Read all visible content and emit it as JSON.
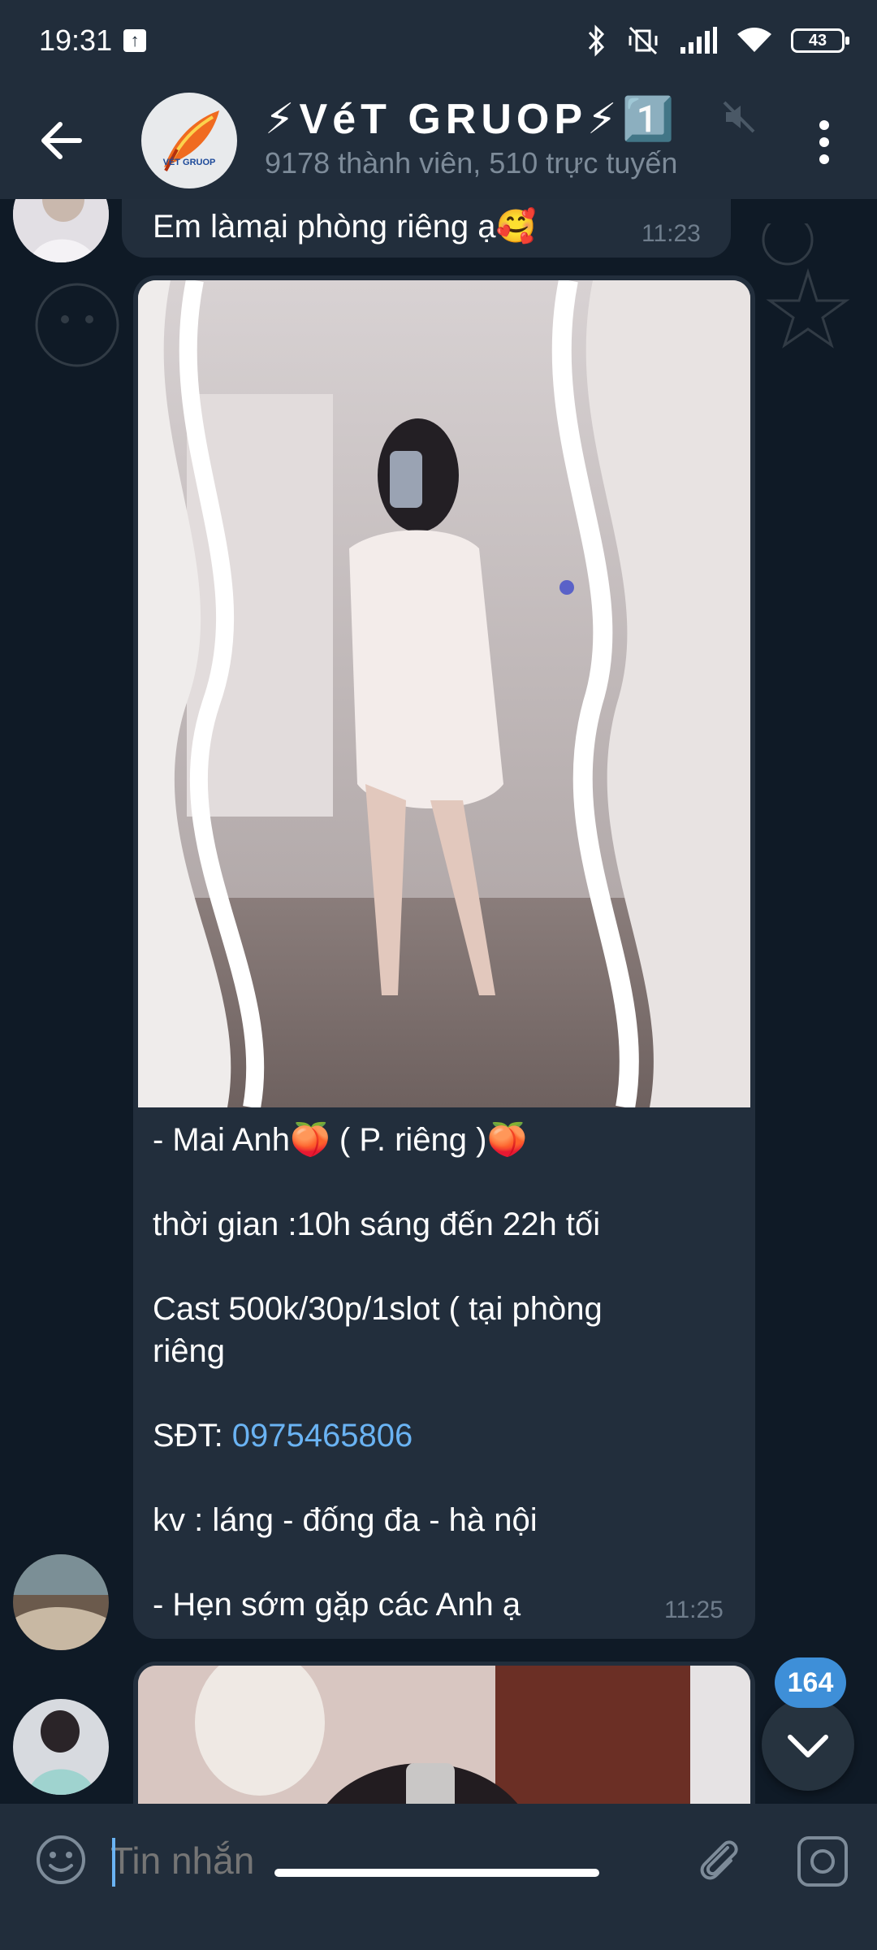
{
  "status_bar": {
    "time": "19:31",
    "battery": "43"
  },
  "header": {
    "title": "⚡VéT GRUOP⚡1️⃣",
    "subtitle": "9178 thành viên, 510 trực tuyến",
    "avatar_text": "VÉT GRUOP"
  },
  "messages": [
    {
      "text": "Em làmại phòng riêng ạ🥰",
      "time": "11:23"
    },
    {
      "caption": [
        "- Mai Anh🍑 ( P. riêng )🍑",
        "thời gian :10h sáng đến 22h tối",
        "Cast 500k/30p/1slot ( tại phòng",
        "riêng",
        "SĐT: ",
        "0975465806",
        "kv : láng - đống đa - hà nội",
        "- Hẹn sớm gặp các Anh ạ"
      ],
      "time": "11:25"
    }
  ],
  "scroll_button": {
    "unread_count": "164"
  },
  "input": {
    "placeholder": "Tin nhắn"
  },
  "colors": {
    "bg": "#0f1a26",
    "bar": "#212d3b",
    "bubble": "#222e3c",
    "link": "#6ab3f3",
    "badge": "#3e8fd8"
  }
}
